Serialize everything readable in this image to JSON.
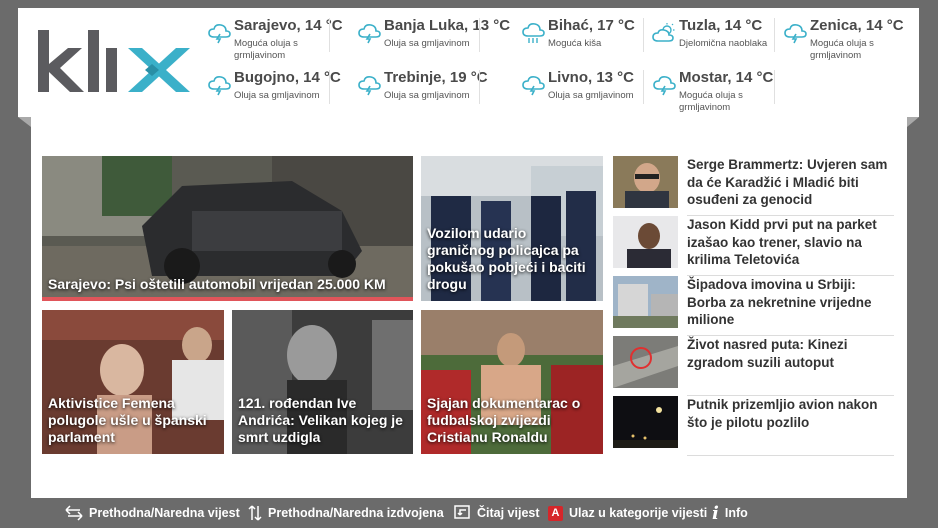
{
  "header": {
    "logo_text": "klix",
    "weather": [
      {
        "city": "Sarajevo, 14 °C",
        "condition": "Moguća oluja s grmljavinom",
        "icon": "storm-cloud-icon"
      },
      {
        "city": "Banja Luka, 13 °C",
        "condition": "Oluja sa gmljavinom",
        "icon": "storm-cloud-icon"
      },
      {
        "city": "Bihać, 17 °C",
        "condition": "Moguća kiša",
        "icon": "rain-cloud-icon"
      },
      {
        "city": "Tuzla, 14 °C",
        "condition": "Djelomična naoblaka",
        "icon": "partly-cloudy-icon"
      },
      {
        "city": "Zenica, 14 °C",
        "condition": "Moguća oluja s grmljavinom",
        "icon": "storm-cloud-icon"
      },
      {
        "city": "Bugojno, 14 °C",
        "condition": "Oluja sa gmljavinom",
        "icon": "storm-cloud-icon"
      },
      {
        "city": "Trebinje, 19 °C",
        "condition": "Oluja sa gmljavinom",
        "icon": "storm-cloud-icon"
      },
      {
        "city": "Livno, 13 °C",
        "condition": "Oluja sa gmljavinom",
        "icon": "storm-cloud-icon"
      },
      {
        "city": "Mostar, 14 °C",
        "condition": "Moguća oluja s grmljavinom",
        "icon": "storm-cloud-icon"
      }
    ]
  },
  "tiles": [
    {
      "caption": "Sarajevo: Psi oštetili automobil vrijedan 25.000 KM"
    },
    {
      "caption": "Vozilom udario graničnog policajca pa pokušao pobjeći i baciti drogu"
    },
    {
      "caption": "Aktivistice Femena polugole ušle u španski parlament"
    },
    {
      "caption": "121. rođendan Ive Andrića: Velikan kojeg je smrt uzdigla"
    },
    {
      "caption": "Sjajan dokumentarac o fudbalskoj zvijezdi Cristianu Ronaldu"
    }
  ],
  "sidebar": [
    {
      "title": "Serge Brammertz: Uvjeren sam da će Karadžić i Mladić biti osuđeni za genocid"
    },
    {
      "title": "Jason Kidd prvi put na parket izašao kao trener, slavio na krilima Teletovića"
    },
    {
      "title": "Šipadova imovina u Srbiji: Borba za nekretnine vrijedne milione"
    },
    {
      "title": "Život nasred puta: Kinezi zgradom suzili autoput"
    },
    {
      "title": "Putnik prizemljio avion nakon što je pilotu pozlilo"
    }
  ],
  "footer": {
    "prev_next_news": "Prethodna/Naredna vijest",
    "prev_next_featured": "Prethodna/Naredna izdvojena",
    "read_news": "Čitaj vijest",
    "category_key": "A",
    "enter_category": "Ulaz u kategorije vijesti",
    "info": "Info"
  },
  "colors": {
    "accent": "#3bb0c9",
    "logo_gray": "#5b5b5f",
    "highlight_bar": "#e0555a"
  }
}
